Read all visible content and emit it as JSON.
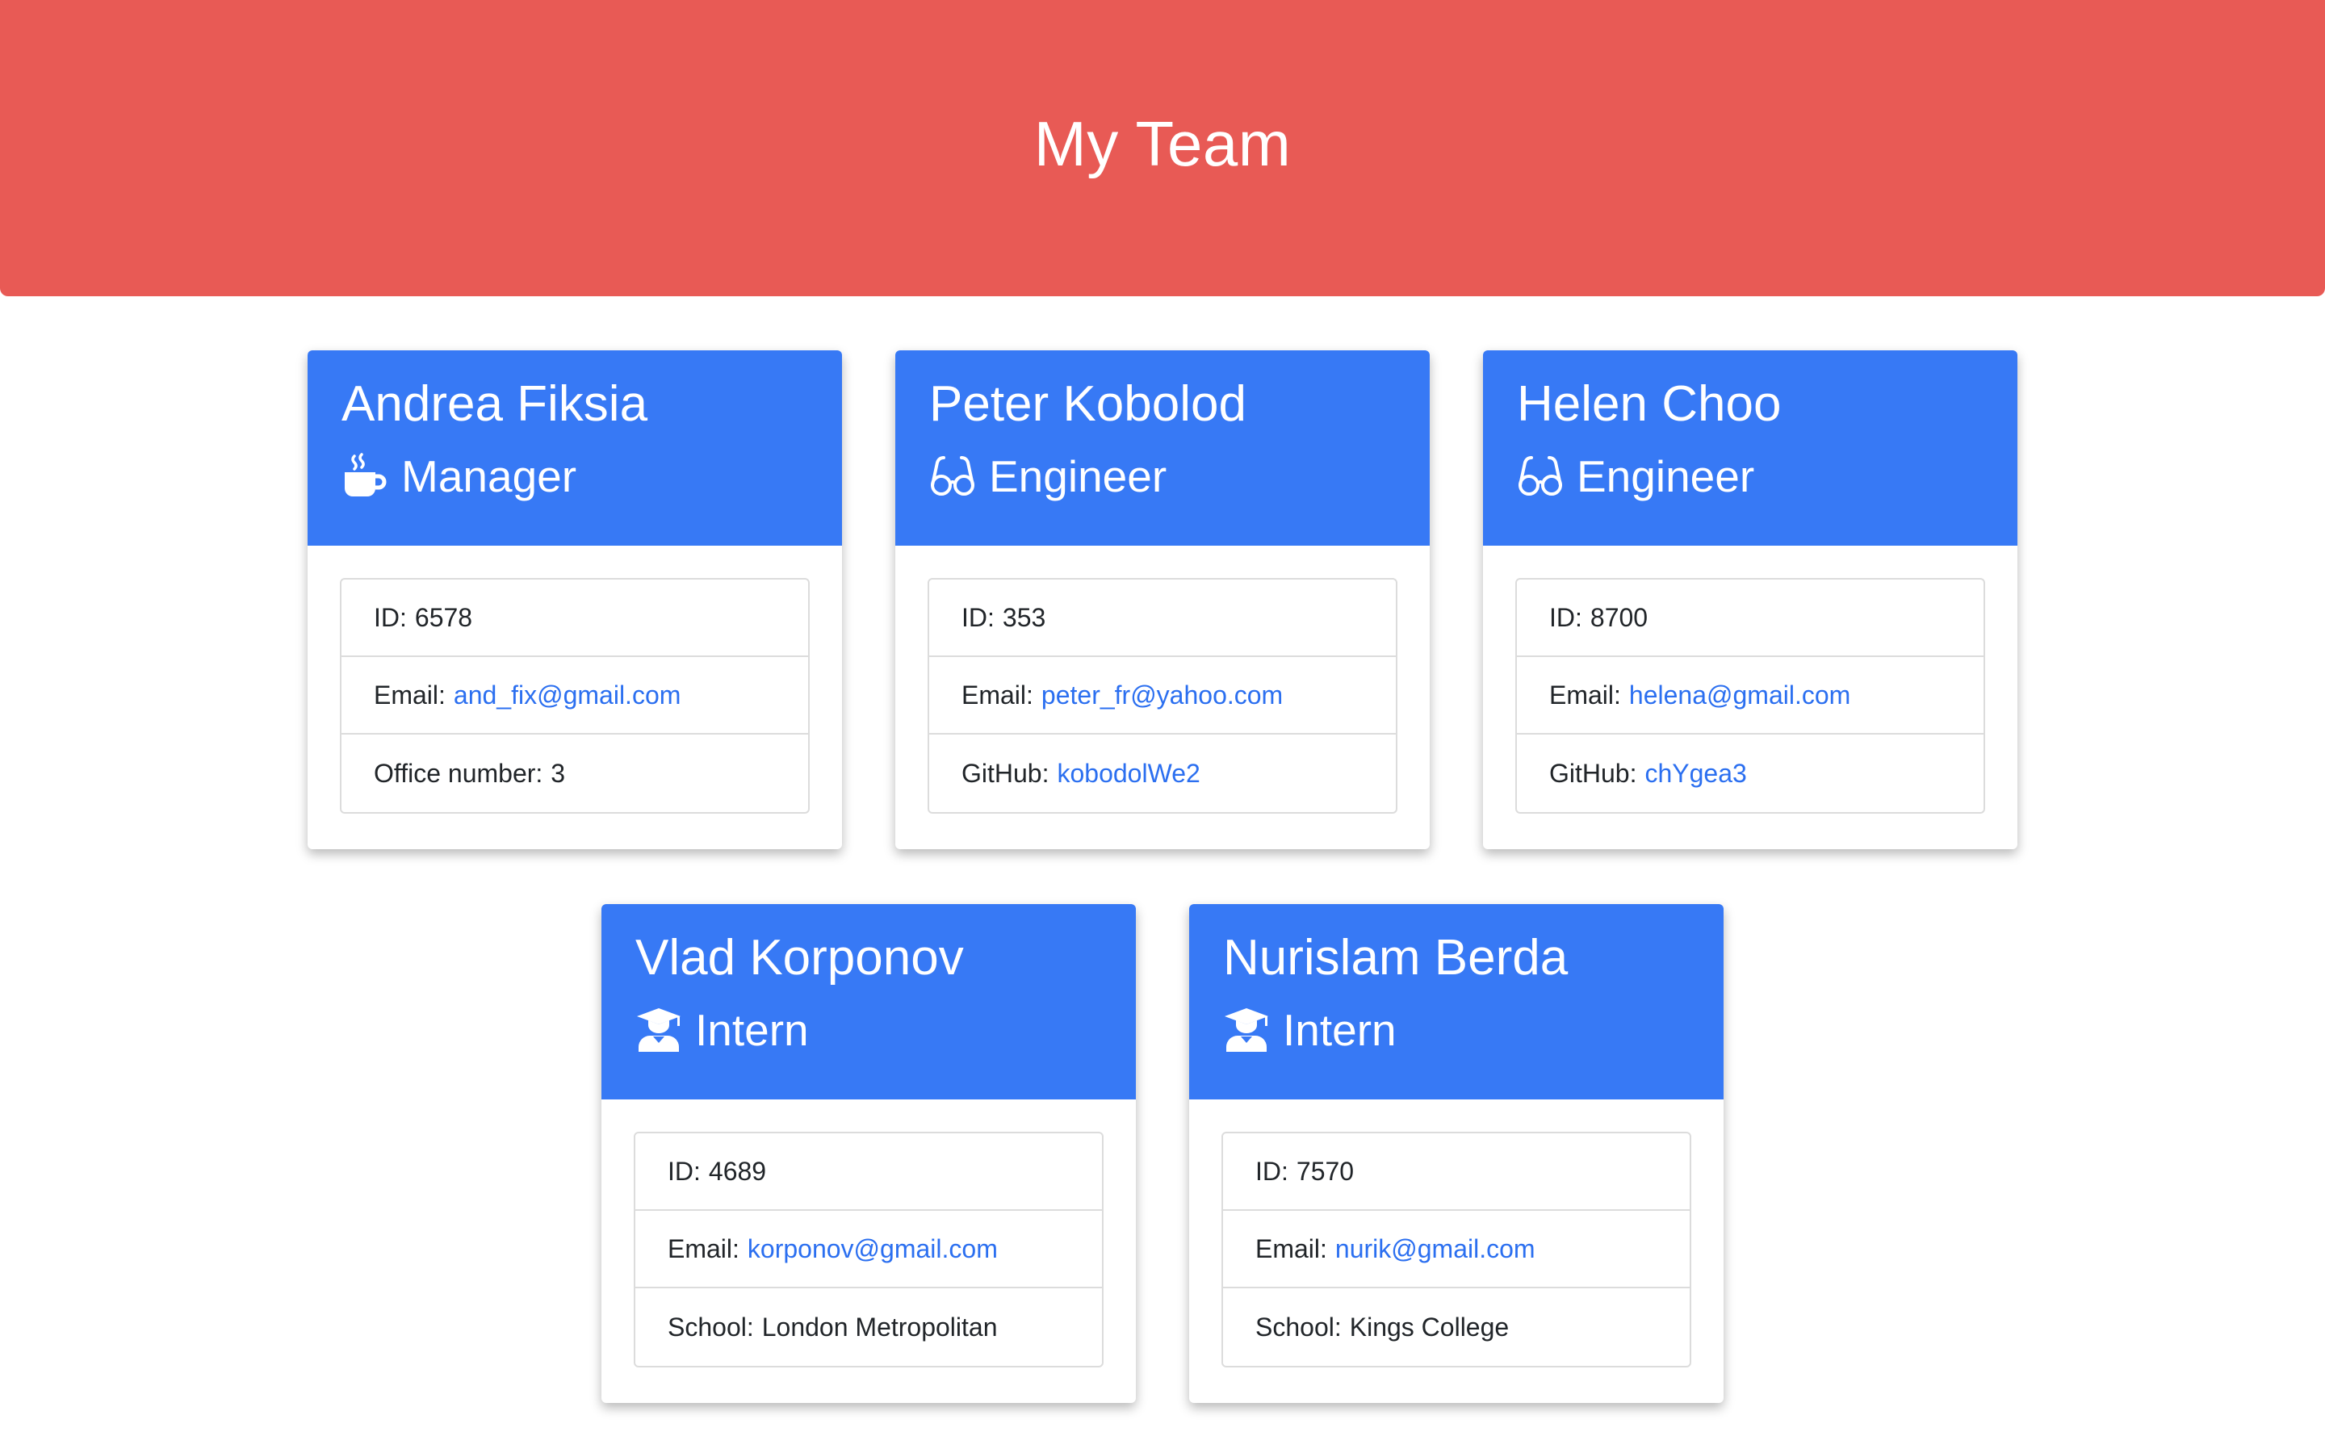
{
  "header": {
    "title": "My Team"
  },
  "colors": {
    "header_bg": "#e85a55",
    "card_header_bg": "#3779f5",
    "link": "#2b6ff0"
  },
  "cards": [
    {
      "name": "Andrea Fiksia",
      "role": "Manager",
      "icon": "coffee-mug-icon",
      "id_label": "ID:",
      "id": "6578",
      "email_label": "Email:",
      "email": "and_fix@gmail.com",
      "extra_label": "Office number:",
      "extra": "3"
    },
    {
      "name": "Peter Kobolod",
      "role": "Engineer",
      "icon": "glasses-icon",
      "id_label": "ID:",
      "id": "353",
      "email_label": "Email:",
      "email": "peter_fr@yahoo.com",
      "extra_label": "GitHub:",
      "extra": "kobodolWe2"
    },
    {
      "name": "Helen Choo",
      "role": "Engineer",
      "icon": "glasses-icon",
      "id_label": "ID:",
      "id": "8700",
      "email_label": "Email:",
      "email": "helena@gmail.com",
      "extra_label": "GitHub:",
      "extra": "chYgea3"
    },
    {
      "name": "Vlad Korponov",
      "role": "Intern",
      "icon": "graduate-icon",
      "id_label": "ID:",
      "id": "4689",
      "email_label": "Email:",
      "email": "korponov@gmail.com",
      "extra_label": "School:",
      "extra": "London Metropolitan"
    },
    {
      "name": "Nurislam Berda",
      "role": "Intern",
      "icon": "graduate-icon",
      "id_label": "ID:",
      "id": "7570",
      "email_label": "Email:",
      "email": "nurik@gmail.com",
      "extra_label": "School:",
      "extra": "Kings College"
    }
  ]
}
